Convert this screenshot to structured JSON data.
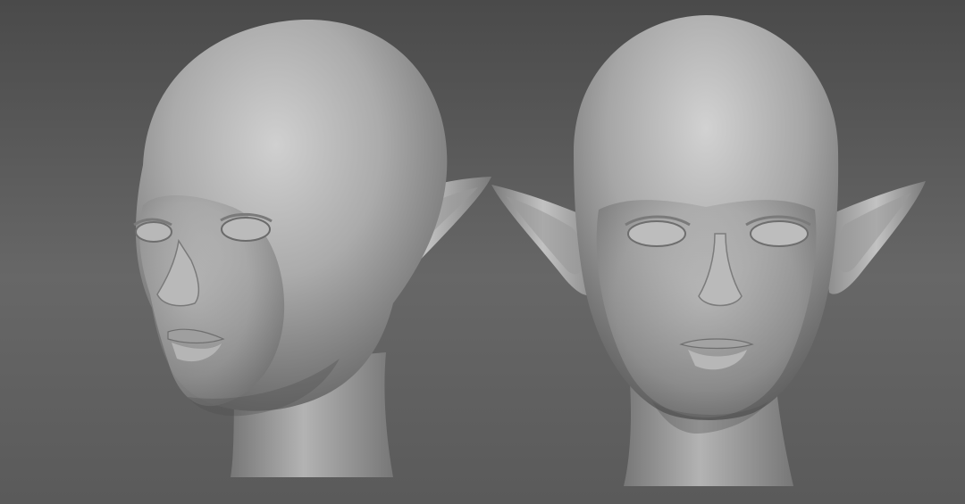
{
  "scene": {
    "background_top": "#4a4a4a",
    "background_mid": "#676767",
    "background_bottom": "#5a5a5a",
    "clay_light": "#c9c9c9",
    "clay_mid": "#9b9b9b",
    "clay_dark": "#5b5b5b",
    "models": [
      {
        "name": "elf-head-three-quarter-view",
        "view": "three-quarter"
      },
      {
        "name": "elf-head-front-view",
        "view": "front"
      }
    ]
  }
}
